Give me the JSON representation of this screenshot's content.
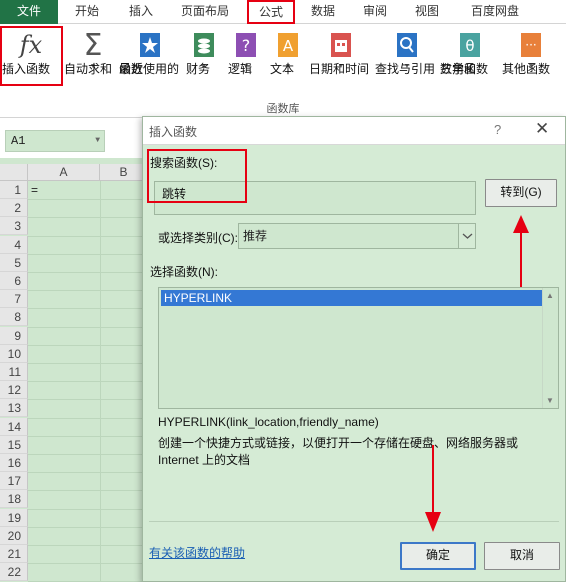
{
  "ribbon_tabs": [
    {
      "label": "文件"
    },
    {
      "label": "开始"
    },
    {
      "label": "插入"
    },
    {
      "label": "页面布局"
    },
    {
      "label": "公式"
    },
    {
      "label": "数据"
    },
    {
      "label": "审阅"
    },
    {
      "label": "视图"
    },
    {
      "label": "百度网盘"
    }
  ],
  "ribbon": {
    "insert_function": {
      "line1": "插入函数",
      "icon": "fx-icon"
    },
    "autosum": {
      "line1": "自动求和",
      "icon": "sigma-icon"
    },
    "recent": {
      "line1": "最近使用的",
      "line2": "函数",
      "icon": "star-book-icon"
    },
    "financial": {
      "line1": "财务",
      "icon": "coins-book-icon"
    },
    "logical": {
      "line1": "逻辑",
      "icon": "question-book-icon"
    },
    "text": {
      "line1": "文本",
      "icon": "text-book-icon"
    },
    "datetime": {
      "line1": "日期和时间",
      "icon": "calendar-book-icon"
    },
    "lookup": {
      "line1": "查找与引用",
      "icon": "magnifier-book-icon"
    },
    "math": {
      "line1": "数学和",
      "line2": "三角函数",
      "icon": "theta-book-icon"
    },
    "more": {
      "line1": "其他函数",
      "icon": "dots-book-icon"
    },
    "group_label": "函数库"
  },
  "namebox": {
    "value": "A1"
  },
  "sheet": {
    "col_a": "A",
    "col_b": "B",
    "a1_value": "=",
    "rows": [
      "1",
      "2",
      "3",
      "4",
      "5",
      "6",
      "7",
      "8",
      "9",
      "10",
      "11",
      "12",
      "13",
      "14",
      "15",
      "16",
      "17",
      "18",
      "19",
      "20",
      "21",
      "22"
    ]
  },
  "dialog": {
    "title": "插入函数",
    "help_q": "?",
    "close": "✕",
    "search_label": "搜索函数(S):",
    "search_value": "跳转",
    "goto_button": "转到(G)",
    "category_label": "或选择类别(C):",
    "category_value": "推荐",
    "select_label": "选择函数(N):",
    "functions": [
      "HYPERLINK"
    ],
    "signature": "HYPERLINK(link_location,friendly_name)",
    "description_line1": "创建一个快捷方式或链接，以便打开一个存储在硬盘、网络服务器或",
    "description_line2": "Internet 上的文档",
    "help_link": "有关该函数的帮助",
    "ok_button": "确定",
    "cancel_button": "取消"
  },
  "colors": {
    "excel_green": "#217346",
    "highlight_red": "#e60012",
    "selection_blue": "#3478d4",
    "eye_care_green": "#cfe7cf"
  }
}
